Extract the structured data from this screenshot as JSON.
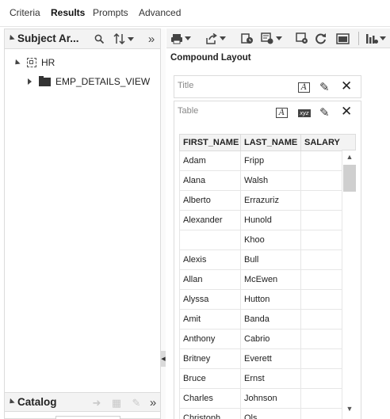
{
  "tabs": [
    {
      "label": "Criteria",
      "active": false
    },
    {
      "label": "Results",
      "active": true
    },
    {
      "label": "Prompts",
      "active": false
    },
    {
      "label": "Advanced",
      "active": false
    }
  ],
  "subject_areas": {
    "title": "Subject Ar...",
    "tree": {
      "root": "HR",
      "child": "EMP_DETAILS_VIEW"
    }
  },
  "catalog": {
    "title": "Catalog"
  },
  "layout": {
    "title": "Compound Layout",
    "title_view": {
      "label": "Title"
    },
    "table_view": {
      "label": "Table"
    }
  },
  "table": {
    "columns": [
      "FIRST_NAME",
      "LAST_NAME",
      "SALARY"
    ],
    "rows": [
      {
        "first_name": "Adam",
        "last_name": "Fripp",
        "salary": ""
      },
      {
        "first_name": "Alana",
        "last_name": "Walsh",
        "salary": ""
      },
      {
        "first_name": "Alberto",
        "last_name": "Errazuriz",
        "salary": ""
      },
      {
        "first_name": "Alexander",
        "last_name": "Hunold",
        "salary": ""
      },
      {
        "first_name": "",
        "last_name": "Khoo",
        "salary": ""
      },
      {
        "first_name": "Alexis",
        "last_name": "Bull",
        "salary": ""
      },
      {
        "first_name": "Allan",
        "last_name": "McEwen",
        "salary": ""
      },
      {
        "first_name": "Alyssa",
        "last_name": "Hutton",
        "salary": ""
      },
      {
        "first_name": "Amit",
        "last_name": "Banda",
        "salary": ""
      },
      {
        "first_name": "Anthony",
        "last_name": "Cabrio",
        "salary": ""
      },
      {
        "first_name": "Britney",
        "last_name": "Everett",
        "salary": ""
      },
      {
        "first_name": "Bruce",
        "last_name": "Ernst",
        "salary": ""
      },
      {
        "first_name": "Charles",
        "last_name": "Johnson",
        "salary": ""
      },
      {
        "first_name": "Christoph...",
        "last_name": "Ols...",
        "salary": ""
      }
    ]
  },
  "icons": {
    "search": "search-icon",
    "sort": "sort-icon",
    "collapse_panel": "double-chevron-right-icon",
    "print": "print-icon",
    "export": "export-icon",
    "settings": "settings-icon",
    "refresh": "refresh-icon",
    "close": "close-icon",
    "edit": "pencil-icon"
  },
  "colors": {
    "header_bg": "#f3f3f3",
    "border": "#dcdcdc",
    "text": "#222222"
  }
}
